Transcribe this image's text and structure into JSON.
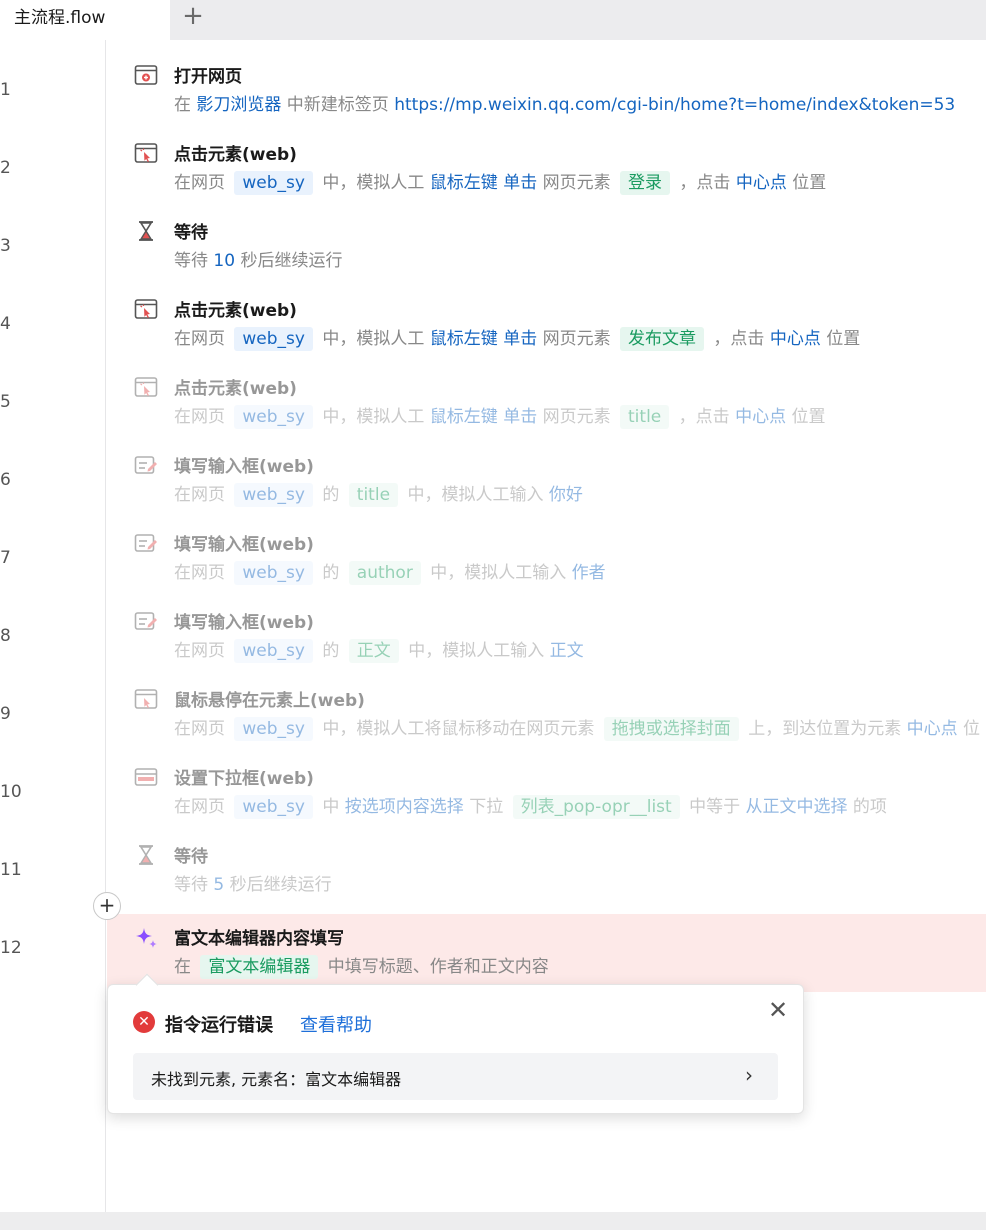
{
  "tabs": {
    "active_label": "主流程.flow",
    "add_label": "+"
  },
  "steps": [
    {
      "no": "1",
      "title": "打开网页",
      "icon": "browser-open-icon",
      "desc": [
        [
          "t",
          "在 "
        ],
        [
          "k",
          "影刀浏览器"
        ],
        [
          "t",
          " 中新建标签页 "
        ],
        [
          "k",
          "https://mp.weixin.qq.com/cgi-bin/home?t=home/index&token=53"
        ]
      ]
    },
    {
      "no": "2",
      "title": "点击元素(web)",
      "icon": "click-element-icon",
      "desc": [
        [
          "t",
          "在网页 "
        ],
        [
          "b",
          "web_sy"
        ],
        [
          "t",
          " 中，模拟人工 "
        ],
        [
          "k",
          "鼠标左键"
        ],
        [
          "t",
          " "
        ],
        [
          "k",
          "单击"
        ],
        [
          "t",
          " 网页元素 "
        ],
        [
          "g",
          "登录"
        ],
        [
          "t",
          " ，点击 "
        ],
        [
          "k",
          "中心点"
        ],
        [
          "t",
          " 位置"
        ]
      ]
    },
    {
      "no": "3",
      "title": "等待",
      "icon": "hourglass-icon",
      "desc": [
        [
          "t",
          "等待 "
        ],
        [
          "k",
          "10"
        ],
        [
          "t",
          " 秒后继续运行"
        ]
      ]
    },
    {
      "no": "4",
      "title": "点击元素(web)",
      "icon": "click-element-icon",
      "desc": [
        [
          "t",
          "在网页 "
        ],
        [
          "b",
          "web_sy"
        ],
        [
          "t",
          " 中，模拟人工 "
        ],
        [
          "k",
          "鼠标左键"
        ],
        [
          "t",
          " "
        ],
        [
          "k",
          "单击"
        ],
        [
          "t",
          " 网页元素 "
        ],
        [
          "g",
          "发布文章"
        ],
        [
          "t",
          " ，点击 "
        ],
        [
          "k",
          "中心点"
        ],
        [
          "t",
          " 位置"
        ]
      ]
    },
    {
      "no": "5",
      "title": "点击元素(web)",
      "icon": "click-element-icon",
      "disabled": true,
      "desc": [
        [
          "t",
          "在网页 "
        ],
        [
          "b",
          "web_sy"
        ],
        [
          "t",
          " 中，模拟人工 "
        ],
        [
          "k",
          "鼠标左键"
        ],
        [
          "t",
          " "
        ],
        [
          "k",
          "单击"
        ],
        [
          "t",
          " 网页元素 "
        ],
        [
          "g",
          "title"
        ],
        [
          "t",
          " ，点击 "
        ],
        [
          "k",
          "中心点"
        ],
        [
          "t",
          " 位置"
        ]
      ]
    },
    {
      "no": "6",
      "title": "填写输入框(web)",
      "icon": "fill-input-icon",
      "disabled": true,
      "desc": [
        [
          "t",
          "在网页 "
        ],
        [
          "b",
          "web_sy"
        ],
        [
          "t",
          " 的 "
        ],
        [
          "g",
          "title"
        ],
        [
          "t",
          " 中，模拟人工输入 "
        ],
        [
          "k",
          "你好"
        ]
      ]
    },
    {
      "no": "7",
      "title": "填写输入框(web)",
      "icon": "fill-input-icon",
      "disabled": true,
      "desc": [
        [
          "t",
          "在网页 "
        ],
        [
          "b",
          "web_sy"
        ],
        [
          "t",
          " 的 "
        ],
        [
          "g",
          "author"
        ],
        [
          "t",
          " 中，模拟人工输入 "
        ],
        [
          "k",
          "作者"
        ]
      ]
    },
    {
      "no": "8",
      "title": "填写输入框(web)",
      "icon": "fill-input-icon",
      "disabled": true,
      "desc": [
        [
          "t",
          "在网页 "
        ],
        [
          "b",
          "web_sy"
        ],
        [
          "t",
          " 的 "
        ],
        [
          "g",
          "正文"
        ],
        [
          "t",
          " 中，模拟人工输入 "
        ],
        [
          "k",
          "正文"
        ]
      ]
    },
    {
      "no": "9",
      "title": "鼠标悬停在元素上(web)",
      "icon": "hover-element-icon",
      "disabled": true,
      "desc": [
        [
          "t",
          "在网页 "
        ],
        [
          "b",
          "web_sy"
        ],
        [
          "t",
          " 中，模拟人工将鼠标移动在网页元素 "
        ],
        [
          "g",
          "拖拽或选择封面"
        ],
        [
          "t",
          " 上，到达位置为元素 "
        ],
        [
          "k",
          "中心点"
        ],
        [
          "t",
          " 位"
        ]
      ]
    },
    {
      "no": "10",
      "title": "设置下拉框(web)",
      "icon": "dropdown-icon",
      "disabled": true,
      "desc": [
        [
          "t",
          "在网页 "
        ],
        [
          "b",
          "web_sy"
        ],
        [
          "t",
          " 中 "
        ],
        [
          "k",
          "按选项内容选择"
        ],
        [
          "t",
          " 下拉 "
        ],
        [
          "g",
          "列表_pop-opr__list"
        ],
        [
          "t",
          " 中等于 "
        ],
        [
          "k",
          "从正文中选择"
        ],
        [
          "t",
          " 的项"
        ]
      ]
    },
    {
      "no": "11",
      "title": "等待",
      "icon": "hourglass-icon",
      "disabled": true,
      "desc": [
        [
          "t",
          "等待 "
        ],
        [
          "k",
          "5"
        ],
        [
          "t",
          " 秒后继续运行"
        ]
      ]
    },
    {
      "no": "12",
      "title": "富文本编辑器内容填写",
      "icon": "ai-sparkle-icon",
      "error": true,
      "desc": [
        [
          "t",
          "在 "
        ],
        [
          "g",
          "富文本编辑器"
        ],
        [
          "t",
          " 中填写标题、作者和正文内容"
        ]
      ]
    }
  ],
  "add_step": "+",
  "error_popup": {
    "icon": "error-x-icon",
    "title": "指令运行错误",
    "help_link": "查看帮助",
    "close": "✕",
    "message": "未找到元素, 元素名：富文本编辑器",
    "chevron": "›"
  },
  "colors": {
    "keyword": "#1565c0",
    "element": "#1a9b60",
    "error_bg": "#fde9e8",
    "error_red": "#e23b3b"
  }
}
